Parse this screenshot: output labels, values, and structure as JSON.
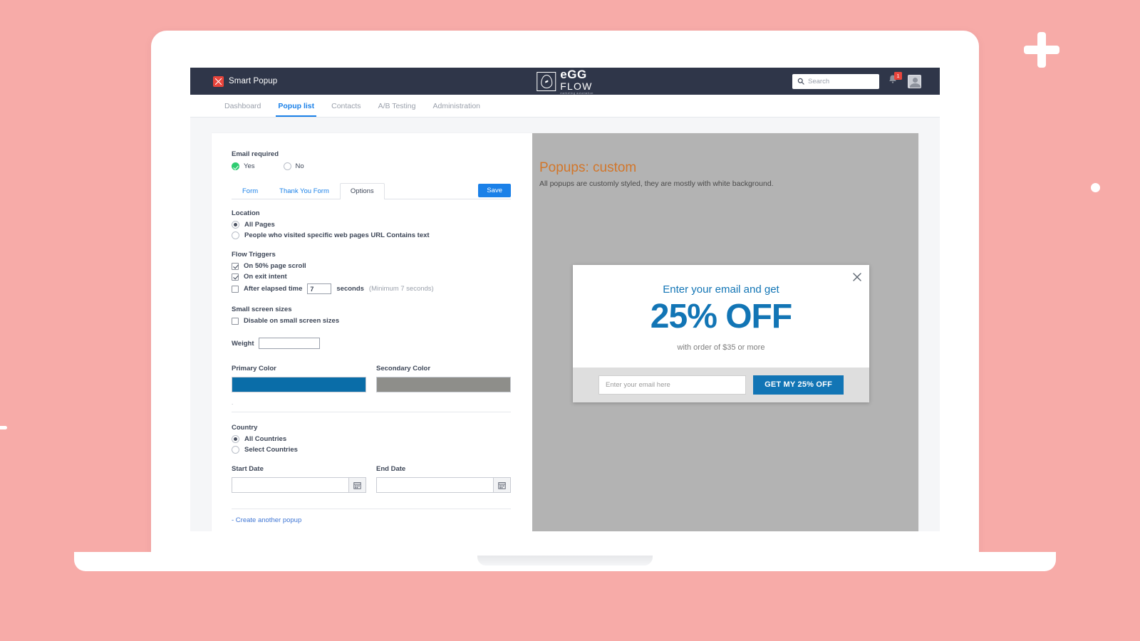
{
  "background": {
    "color": "#f7aba8",
    "accent_white": "#ffffff"
  },
  "navbar": {
    "brand_label": "Smart Popup",
    "brand_icon": "smart-popup-icon",
    "logo": {
      "line1": "eGG",
      "line2": "FLOW",
      "tagline": "marketing automation",
      "mark": "egg-logo-icon"
    },
    "search": {
      "placeholder": "Search",
      "icon": "search-icon",
      "value": ""
    },
    "bell": {
      "icon": "bell-icon",
      "badge": "1"
    },
    "avatar": {
      "icon": "user-avatar-icon"
    }
  },
  "subnav": {
    "items": [
      {
        "label": "Dashboard",
        "active": false
      },
      {
        "label": "Popup list",
        "active": true
      },
      {
        "label": "Contacts",
        "active": false
      },
      {
        "label": "A/B Testing",
        "active": false
      },
      {
        "label": "Administration",
        "active": false
      }
    ]
  },
  "form": {
    "email_required": {
      "label": "Email required",
      "yes_label": "Yes",
      "no_label": "No",
      "selected": "Yes"
    },
    "tabs": [
      {
        "label": "Form",
        "active": false
      },
      {
        "label": "Thank You Form",
        "active": false
      },
      {
        "label": "Options",
        "active": true
      }
    ],
    "save_label": "Save",
    "location": {
      "title": "Location",
      "option_all": "All Pages",
      "option_specific": "People who visited specific web pages URL Contains text",
      "selected": "All Pages"
    },
    "flow_triggers": {
      "title": "Flow Triggers",
      "scroll_label": "On 50% page scroll",
      "scroll_checked": true,
      "exit_label": "On exit intent",
      "exit_checked": true,
      "elapsed_label": "After elapsed time",
      "elapsed_checked": false,
      "elapsed_value": "7",
      "elapsed_unit": "seconds",
      "elapsed_hint": "(Minimum 7 seconds)"
    },
    "small_screen": {
      "title": "Small screen sizes",
      "disable_label": "Disable on small screen sizes",
      "disable_checked": false
    },
    "weight": {
      "label": "Weight",
      "value": ""
    },
    "colors": {
      "primary_label": "Primary Color",
      "primary_value": "#0a6da8",
      "secondary_label": "Secondary Color",
      "secondary_value": "#8e8e8a"
    },
    "stray_dot": ".",
    "country": {
      "title": "Country",
      "option_all": "All Countries",
      "option_select": "Select Countries",
      "selected": "All Countries"
    },
    "dates": {
      "start_label": "Start Date",
      "start_value": "",
      "end_label": "End Date",
      "end_value": "",
      "calendar_icon": "calendar-icon"
    },
    "create_another_label": "- Create another popup"
  },
  "preview": {
    "title": "Popups: custom",
    "title_color": "#d2762a",
    "subtitle": "All popups are customly styled, they are mostly with white background.",
    "background": "#b3b3b3",
    "popup": {
      "close_icon": "close-icon",
      "heading": "Enter your email and get",
      "offer": "25% OFF",
      "note": "with order of $35 or more",
      "email_placeholder": "Enter your email here",
      "cta_label": "GET MY 25% OFF",
      "accent_color": "#1275b5"
    }
  },
  "float_buttons": [
    {
      "icon": "chat-bubble-icon",
      "color": "#1a7fe0"
    },
    {
      "icon": "heart-icon",
      "color": "#1a7fe0"
    }
  ]
}
